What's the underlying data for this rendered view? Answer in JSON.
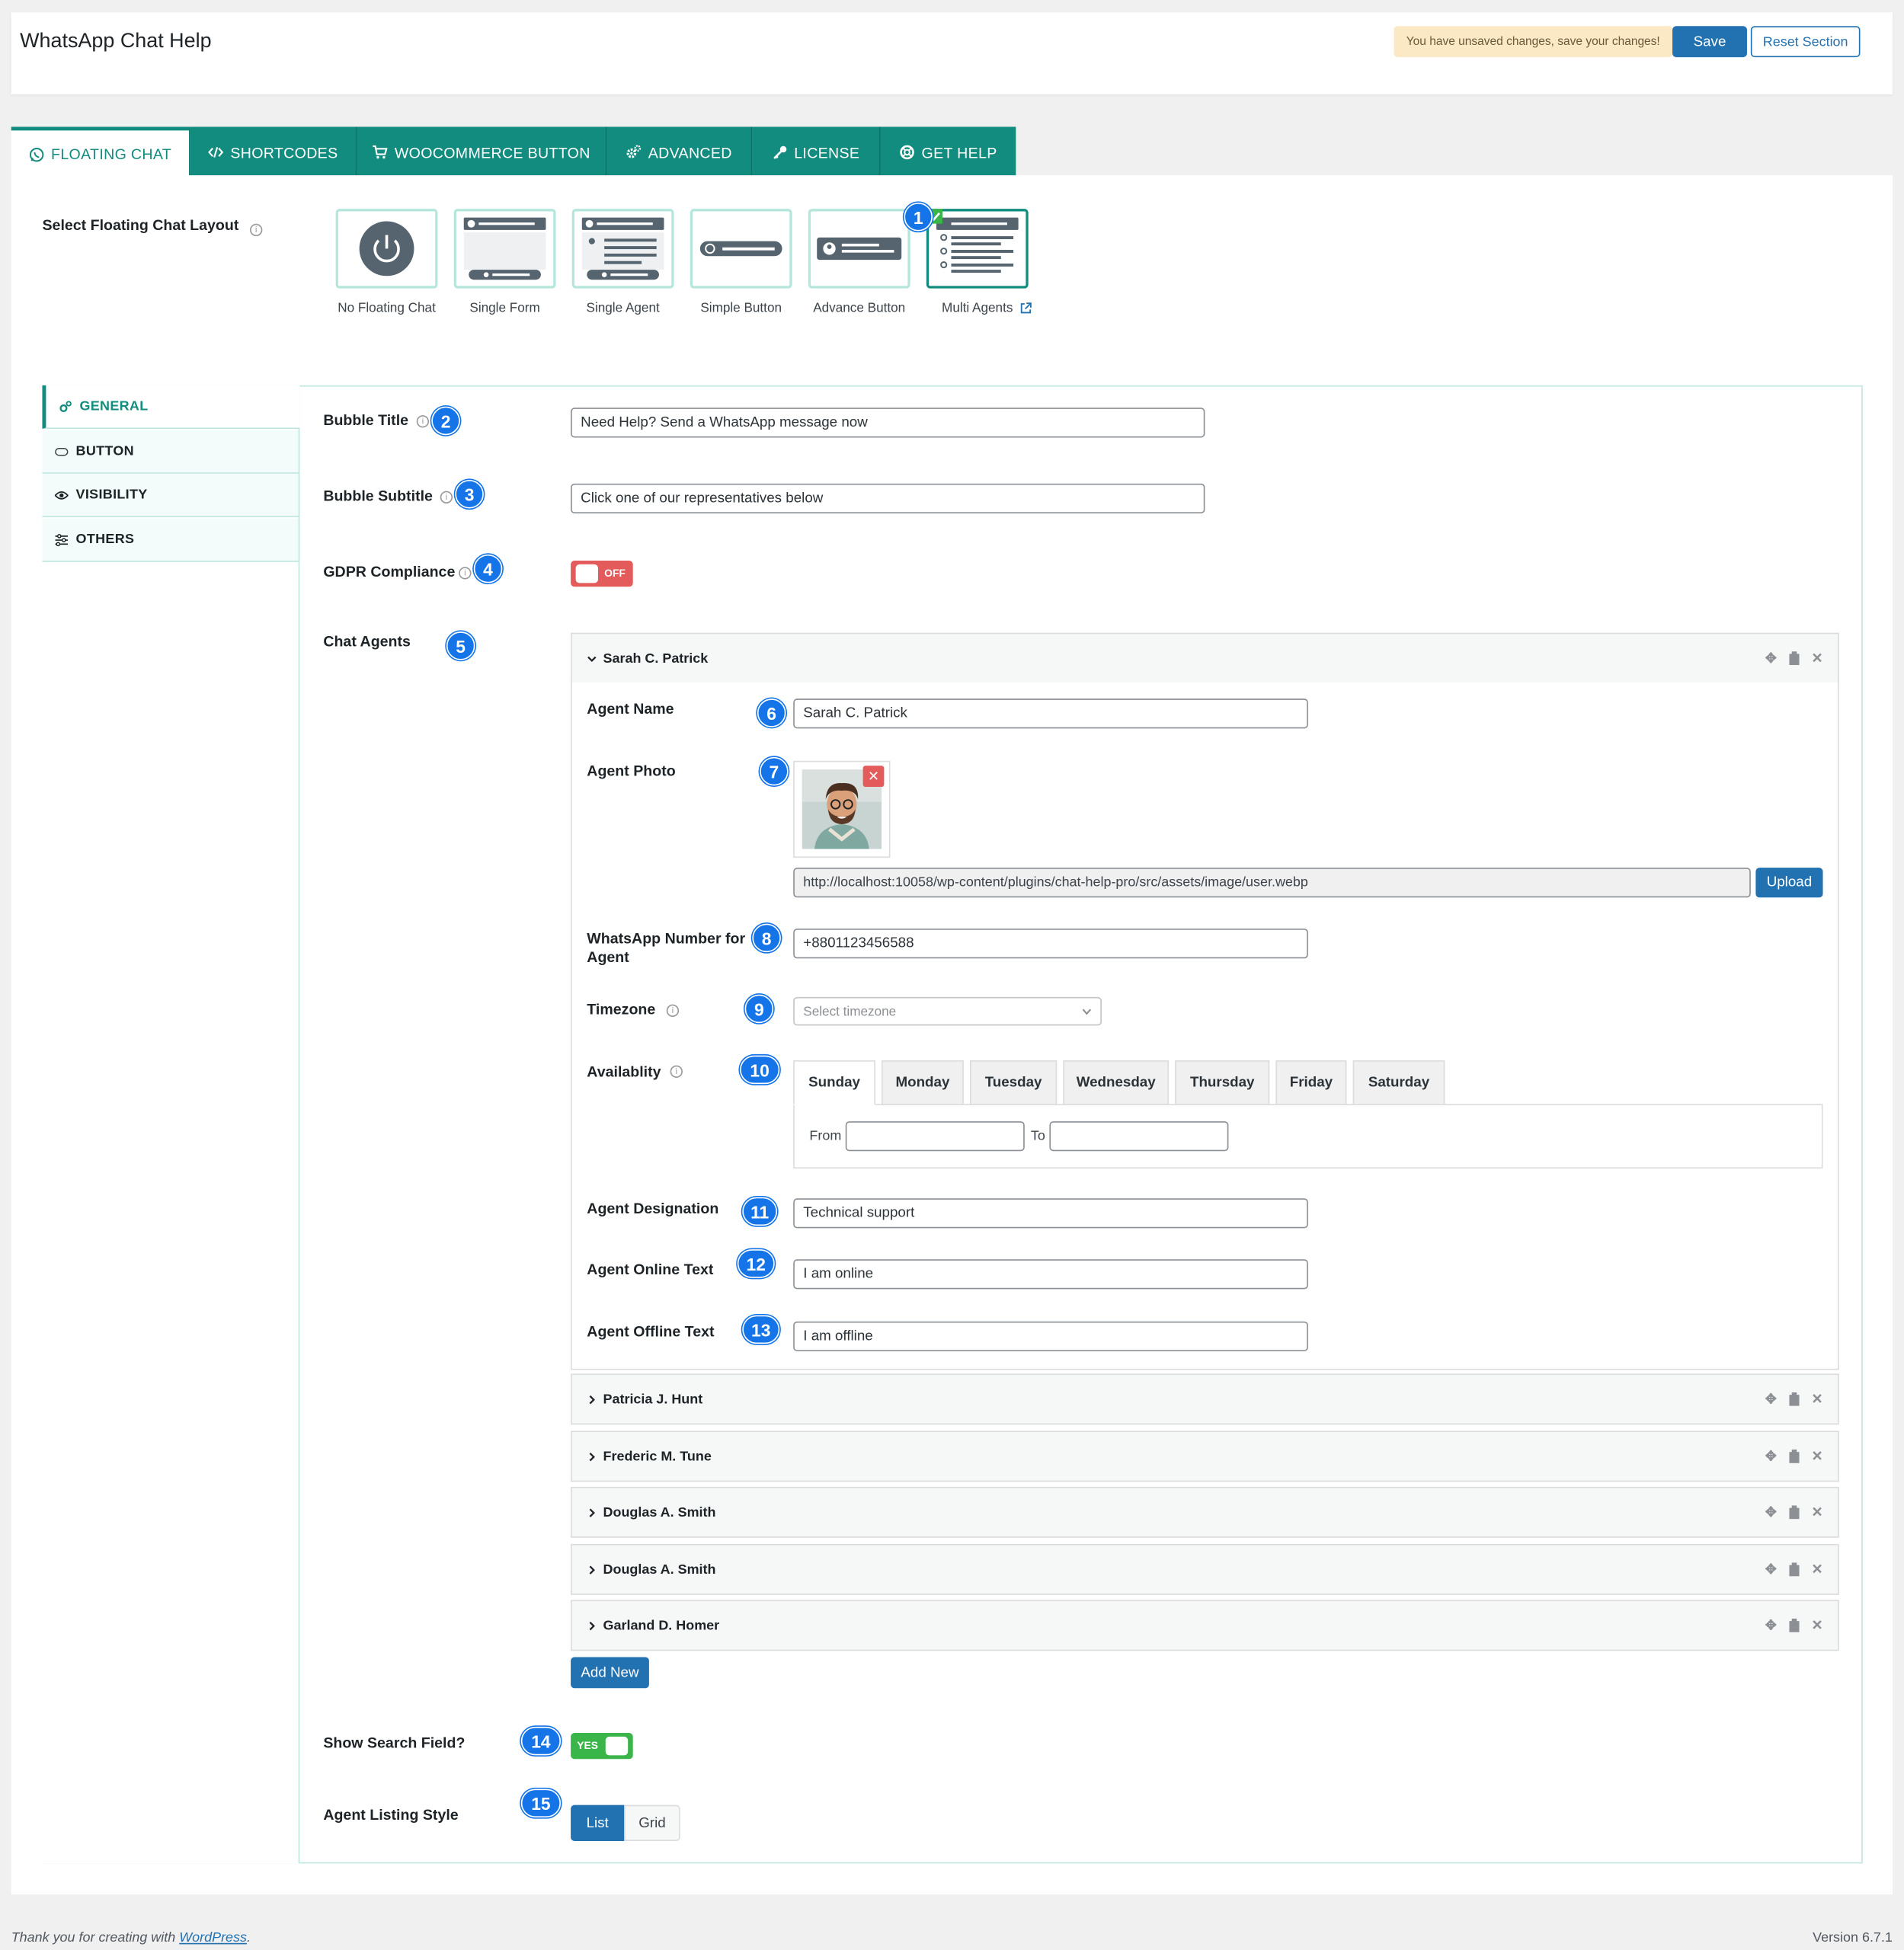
{
  "header": {
    "title": "WhatsApp Chat Help",
    "unsaved_notice": "You have unsaved changes, save your changes!",
    "save_label": "Save",
    "reset_label": "Reset Section"
  },
  "tabs": [
    {
      "label": "FLOATING CHAT",
      "icon": "whatsapp-icon"
    },
    {
      "label": "SHORTCODES",
      "icon": "code-icon"
    },
    {
      "label": "WOOCOMMERCE BUTTON",
      "icon": "cart-icon"
    },
    {
      "label": "ADVANCED",
      "icon": "gears-icon"
    },
    {
      "label": "LICENSE",
      "icon": "key-icon"
    },
    {
      "label": "GET HELP",
      "icon": "lifebuoy-icon"
    }
  ],
  "layout": {
    "label": "Select Floating Chat Layout",
    "options": [
      {
        "name": "No Floating Chat"
      },
      {
        "name": "Single Form"
      },
      {
        "name": "Single Agent"
      },
      {
        "name": "Simple Button"
      },
      {
        "name": "Advance Button"
      },
      {
        "name": "Multi Agents",
        "selected": true
      }
    ]
  },
  "sidebar": {
    "items": [
      {
        "label": "GENERAL",
        "icon": "gears-icon"
      },
      {
        "label": "BUTTON",
        "icon": "button-icon"
      },
      {
        "label": "VISIBILITY",
        "icon": "eye-icon"
      },
      {
        "label": "OTHERS",
        "icon": "sliders-icon"
      }
    ]
  },
  "fields": {
    "bubble_title": {
      "label": "Bubble Title",
      "value": "Need Help? Send a WhatsApp message now"
    },
    "bubble_subtitle": {
      "label": "Bubble Subtitle",
      "value": "Click one of our representatives below"
    },
    "gdpr": {
      "label": "GDPR Compliance",
      "state": "OFF"
    },
    "chat_agents_label": "Chat Agents",
    "show_search": {
      "label": "Show Search Field?",
      "state": "YES"
    },
    "listing_style": {
      "label": "Agent Listing Style",
      "options": [
        "List",
        "Grid"
      ],
      "selected": "List"
    }
  },
  "agent": {
    "name": "Sarah C. Patrick",
    "name_label": "Agent Name",
    "photo_label": "Agent Photo",
    "photo_url": "http://localhost:10058/wp-content/plugins/chat-help-pro/src/assets/image/user.webp",
    "upload_label": "Upload",
    "whatsapp_label_1": "WhatsApp Number for",
    "whatsapp_label_2": "Agent",
    "whatsapp_number": "+8801123456588",
    "timezone_label": "Timezone",
    "timezone_placeholder": "Select timezone",
    "availability_label": "Availablity",
    "days": [
      "Sunday",
      "Monday",
      "Tuesday",
      "Wednesday",
      "Thursday",
      "Friday",
      "Saturday"
    ],
    "from_label": "From",
    "to_label": "To",
    "designation_label": "Agent Designation",
    "designation": "Technical support",
    "online_label": "Agent Online Text",
    "online_text": "I am online",
    "offline_label": "Agent Offline Text",
    "offline_text": "I am offline"
  },
  "other_agents": [
    "Patricia J. Hunt",
    "Frederic M. Tune",
    "Douglas A. Smith",
    "Douglas A. Smith",
    "Garland D. Homer"
  ],
  "add_new_label": "Add New",
  "badges": [
    "1",
    "2",
    "3",
    "4",
    "5",
    "6",
    "7",
    "8",
    "9",
    "10",
    "11",
    "12",
    "13",
    "14",
    "15"
  ],
  "footer": {
    "thanks": "Thank you for creating with ",
    "wp_link": "WordPress",
    "thanks_end": ".",
    "version": "Version 6.7.1"
  },
  "colors": {
    "brand": "#128c7e",
    "primary": "#2271b1",
    "badge": "#1474e8",
    "toggle_off": "#e35b5b",
    "toggle_on": "#3ab54a"
  }
}
